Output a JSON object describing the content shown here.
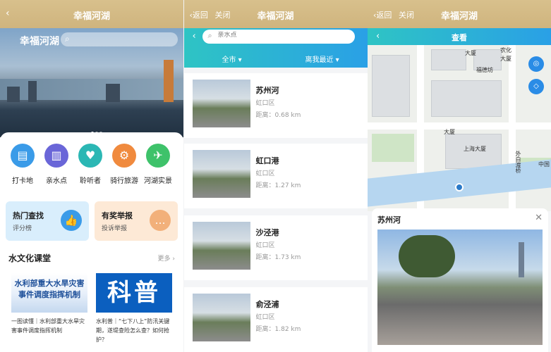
{
  "panel1": {
    "topbar": {
      "title": "幸福河湖"
    },
    "hero": {
      "brand": "幸福河湖"
    },
    "quick": [
      {
        "label": "打卡地",
        "icon": "clipboard-icon",
        "color": "#3a9be8"
      },
      {
        "label": "亲水点",
        "icon": "chart-icon",
        "color": "#6a66d8"
      },
      {
        "label": "聆听者",
        "icon": "heart-icon",
        "color": "#2bb7b4"
      },
      {
        "label": "骑行旅游",
        "icon": "bike-icon",
        "color": "#f08a3e"
      },
      {
        "label": "河湖实景",
        "icon": "compass-icon",
        "color": "#3ec26a"
      }
    ],
    "promo": [
      {
        "title": "热门查找",
        "sub": "评分榜",
        "bg": "#d9eefc",
        "icon": "thumbs-up-icon",
        "icon_color": "#3a9be8"
      },
      {
        "title": "有奖举报",
        "sub": "投诉举报",
        "bg": "#fde9d6",
        "icon": "chat-icon",
        "icon_color": "#f2b07a"
      }
    ],
    "section": {
      "title": "水文化课堂",
      "more": "更多 ›"
    },
    "news": [
      {
        "img_line1": "水利部重大水旱灾害",
        "img_line2": "事件调度指挥机制",
        "caption": "一图读懂｜水利部重大水旱灾害事件调度指挥机制"
      },
      {
        "img_text": "科普",
        "caption": "水利普｜“七下八上”防汛关键期，遂堤查险怎么查？如何抢护？"
      }
    ]
  },
  "panel2": {
    "topbar": {
      "back": "‹返回",
      "close": "关闭",
      "title": "幸福河湖"
    },
    "search": {
      "placeholder": "亲水点"
    },
    "filters": {
      "left": "全市 ▾",
      "right": "离我最近 ▾"
    },
    "items": [
      {
        "name": "苏州河",
        "district": "虹口区",
        "distance": "距离：0.68 km"
      },
      {
        "name": "虹口港",
        "district": "虹口区",
        "distance": "距离：1.27 km"
      },
      {
        "name": "沙泾港",
        "district": "虹口区",
        "distance": "距离：1.73 km"
      },
      {
        "name": "俞泾浦",
        "district": "虹口区",
        "distance": "距离：1.82 km"
      }
    ]
  },
  "panel3": {
    "topbar": {
      "back": "‹返回",
      "close": "关闭",
      "title": "幸福河湖"
    },
    "header": {
      "title": "查看"
    },
    "map_labels": [
      "大厦",
      "农化",
      "大厦",
      "福德坊",
      "大厦",
      "上海大厦",
      "外白渡桥",
      "中国"
    ],
    "detail": {
      "name": "苏州河"
    }
  }
}
